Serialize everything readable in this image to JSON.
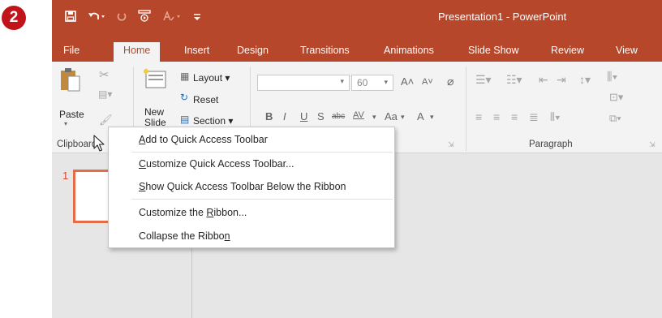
{
  "step_badge": "2",
  "app_title": "Presentation1 - PowerPoint",
  "qat": {
    "save_icon": "save-icon",
    "undo_icon": "undo-icon",
    "redo_icon": "redo-icon",
    "present_icon": "present-icon",
    "spell_icon": "spell-icon",
    "customize_icon": "customize-qat-icon"
  },
  "tabs": [
    "File",
    "Home",
    "Insert",
    "Design",
    "Transitions",
    "Animations",
    "Slide Show",
    "Review",
    "View"
  ],
  "ribbon": {
    "paste_label": "Paste",
    "new_slide_label": "New\nSlide",
    "layout_label": "Layout",
    "reset_label": "Reset",
    "section_label": "Section",
    "font_size": "60",
    "clipboard_group": "Clipboard",
    "paragraph_group": "Paragraph",
    "font_buttons": [
      "B",
      "I",
      "U",
      "S",
      "abc",
      "AV",
      "Aa",
      "A"
    ]
  },
  "slide_number": "1",
  "context_menu": {
    "items": [
      {
        "pre": "",
        "u": "A",
        "post": "dd to Quick Access Toolbar"
      },
      {
        "pre": "",
        "u": "C",
        "post": "ustomize Quick Access Toolbar..."
      },
      {
        "pre": "",
        "u": "S",
        "post": "how Quick Access Toolbar Below the Ribbon"
      },
      {
        "pre": "Customize the ",
        "u": "R",
        "post": "ibbon..."
      },
      {
        "pre": "Collapse the Ribbo",
        "u": "n",
        "post": ""
      }
    ]
  },
  "colors": {
    "accent": "#b7472a",
    "ribbon_bg": "#f3f3f3",
    "workspace": "#e6e6e6",
    "thumb_border": "#e46c48",
    "badge": "#c0141a"
  }
}
